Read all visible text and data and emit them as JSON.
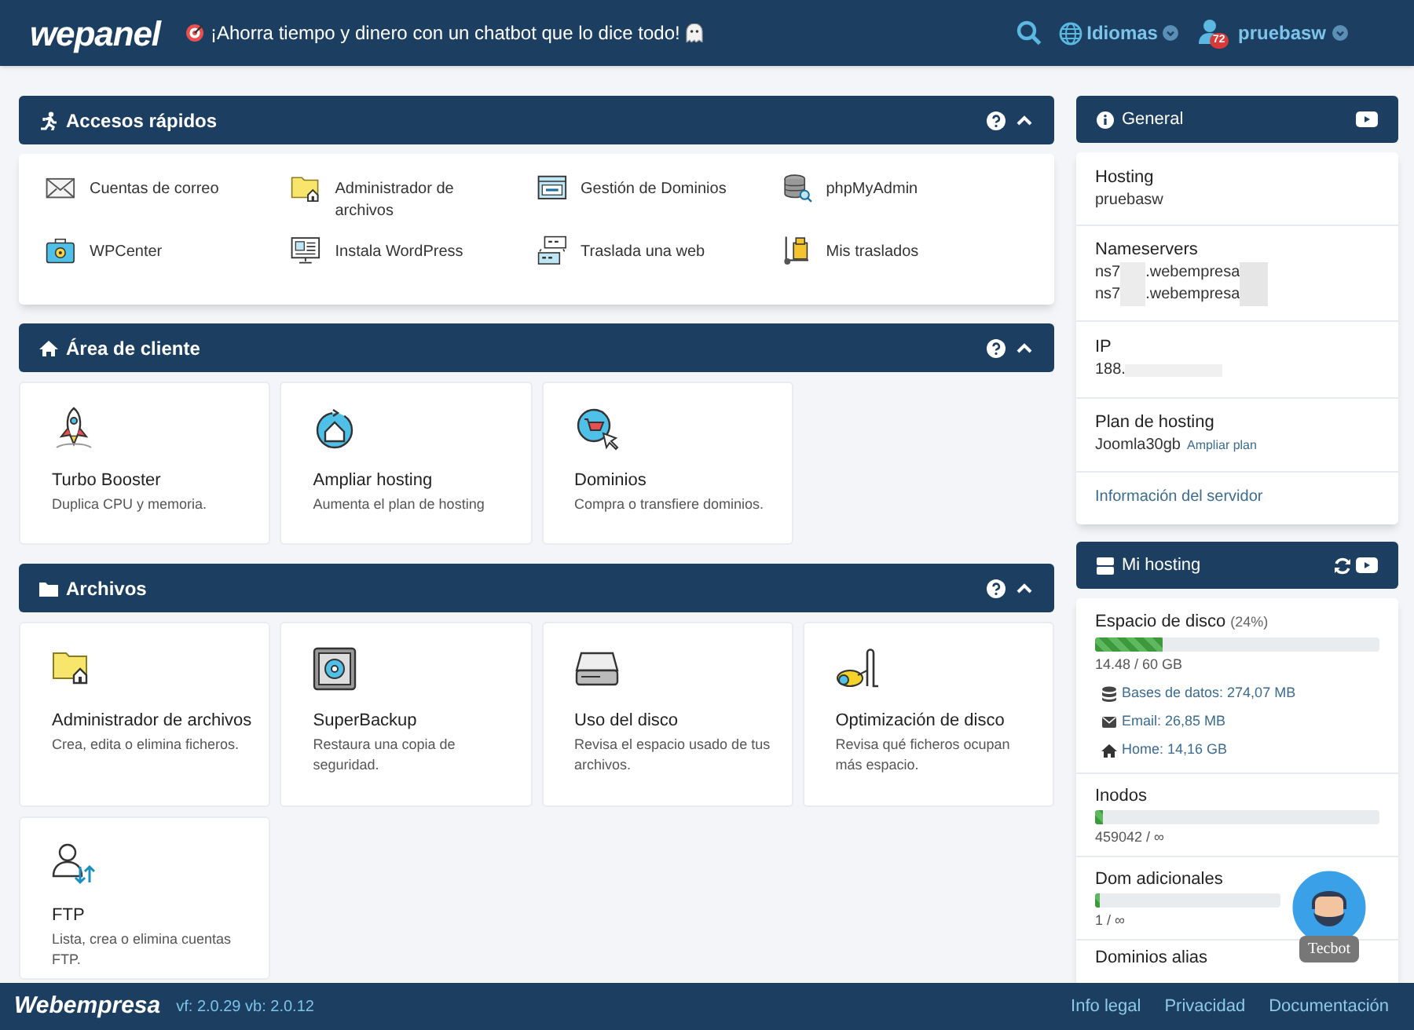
{
  "header": {
    "logo": "wepanel",
    "promo": "¡Ahorra tiempo y dinero con un chatbot que lo dice todo!",
    "language": "Idiomas",
    "notifications": "72",
    "user": "pruebasw"
  },
  "quick_access": {
    "title": "Accesos rápidos",
    "expanded": true,
    "items": [
      {
        "label": "Cuentas de correo"
      },
      {
        "label": "Administrador de archivos"
      },
      {
        "label": "Gestión de Dominios"
      },
      {
        "label": "phpMyAdmin"
      },
      {
        "label": "WPCenter"
      },
      {
        "label": "Instala WordPress"
      },
      {
        "label": "Traslada una web"
      },
      {
        "label": "Mis traslados"
      }
    ]
  },
  "client_area": {
    "title": "Área de cliente",
    "expanded": true,
    "cards": [
      {
        "title": "Turbo Booster",
        "description": "Duplica CPU y memoria."
      },
      {
        "title": "Ampliar hosting",
        "description": "Aumenta el plan de hosting"
      },
      {
        "title": "Dominios",
        "description": "Compra o transfiere dominios."
      }
    ]
  },
  "files": {
    "title": "Archivos",
    "expanded": true,
    "cards": [
      {
        "title": "Administrador de archivos",
        "description": "Crea, edita o elimina ficheros."
      },
      {
        "title": "SuperBackup",
        "description": "Restaura una copia de seguridad."
      },
      {
        "title": "Uso del disco",
        "description": "Revisa el espacio usado de tus archivos."
      },
      {
        "title": "Optimización de disco",
        "description": "Revisa qué ficheros ocupan más espacio."
      },
      {
        "title": "FTP",
        "description": "Lista, crea o elimina cuentas FTP."
      }
    ]
  },
  "general": {
    "title": "General",
    "hosting_label": "Hosting",
    "hosting_value": "pruebasw",
    "nameservers_label": "Nameservers",
    "nameservers": [
      {
        "start": "ns7",
        "end": ".webempresa"
      },
      {
        "start": "ns7",
        "end": ".webempresa"
      }
    ],
    "ip_label": "IP",
    "ip_value": "188.",
    "plan_label": "Plan de hosting",
    "plan_value": "Joomla30gb",
    "plan_link": "Ampliar plan",
    "server_link": "Información del servidor"
  },
  "my_hosting": {
    "title": "Mi hosting",
    "disk": {
      "label": "Espacio de disco",
      "percent": "(24%)",
      "level": 0.24,
      "reading": "14.48 / 60 GB",
      "breakdown": [
        "Bases de datos: 274,07 MB",
        "Email: 26,85 MB",
        "Home: 14,16 GB"
      ]
    },
    "meters": [
      {
        "label": "Inodos",
        "level": 0.01,
        "reading": "459042 / ∞"
      },
      {
        "label": "Dom adicionales",
        "level": 0.01,
        "reading": "1 / ∞"
      }
    ],
    "next_section": "Dominios alias"
  },
  "chatbot": {
    "label": "Tecbot"
  },
  "footer": {
    "logo": "Webempresa",
    "version": "vf: 2.0.29 vb: 2.0.12",
    "links": [
      "Info legal",
      "Privacidad",
      "Documentación"
    ]
  }
}
